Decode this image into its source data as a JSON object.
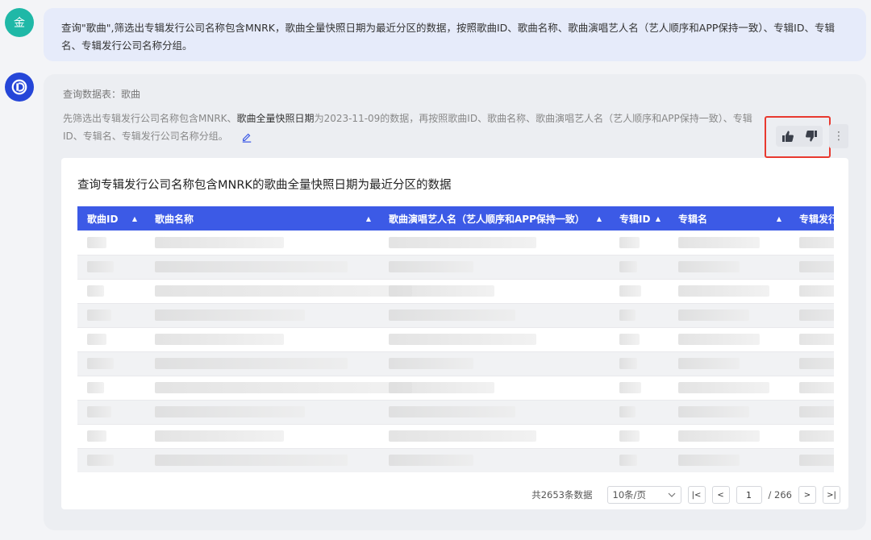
{
  "user": {
    "avatar_text": "金",
    "message": "查询\"歌曲\",筛选出专辑发行公司名称包含MNRK，歌曲全量快照日期为最近分区的数据，按照歌曲ID、歌曲名称、歌曲演唱艺人名（艺人顺序和APP保持一致）、专辑ID、专辑名、专辑发行公司名称分组。"
  },
  "bot": {
    "table_label": "查询数据表：歌曲",
    "explain_pre": "先筛选出专辑发行公司名称包含MNRK、",
    "explain_bold": "歌曲全量快照日期",
    "explain_post": "为2023-11-09的数据，再按照歌曲ID、歌曲名称、歌曲演唱艺人名（艺人顺序和APP保持一致）、专辑ID、专辑名、专辑发行公司名称分组。",
    "more_label": "⋮"
  },
  "result": {
    "title": "查询专辑发行公司名称包含MNRK的歌曲全量快照日期为最近分区的数据",
    "columns": [
      {
        "label": "歌曲ID",
        "sort": "▲"
      },
      {
        "label": "歌曲名称",
        "sort": "▲"
      },
      {
        "label": "歌曲演唱艺人名（艺人顺序和APP保持一致）",
        "sort": "▲"
      },
      {
        "label": "专辑ID",
        "sort": "▲"
      },
      {
        "label": "专辑名",
        "sort": "▲"
      },
      {
        "label": "专辑发行",
        "sort": ""
      }
    ]
  },
  "pager": {
    "total": "共2653条数据",
    "page_size": "10条/页",
    "first": "|<",
    "prev": "<",
    "current": "1",
    "of_total": "/ 266",
    "next": ">",
    "last": ">|"
  },
  "colors": {
    "header_bg": "#3c5ae6",
    "user_avatar": "#1fb8a7",
    "bot_avatar": "#2546d8",
    "highlight_border": "#e8392f"
  }
}
